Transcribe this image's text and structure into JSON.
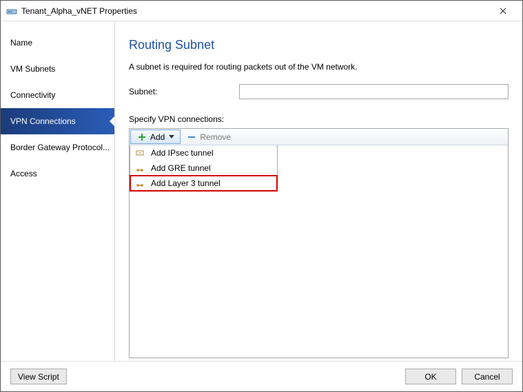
{
  "window": {
    "title": "Tenant_Alpha_vNET Properties"
  },
  "sidebar": {
    "items": [
      {
        "label": "Name",
        "selected": false
      },
      {
        "label": "VM Subnets",
        "selected": false
      },
      {
        "label": "Connectivity",
        "selected": false
      },
      {
        "label": "VPN Connections",
        "selected": true
      },
      {
        "label": "Border Gateway Protocol...",
        "selected": false
      },
      {
        "label": "Access",
        "selected": false
      }
    ]
  },
  "main": {
    "heading": "Routing Subnet",
    "description": "A subnet is required for routing packets out of the VM network.",
    "subnet_label": "Subnet:",
    "subnet_value": "",
    "vpn_label": "Specify VPN connections:",
    "toolbar": {
      "add_label": "Add",
      "remove_label": "Remove"
    },
    "add_menu": {
      "items": [
        {
          "label": "Add IPsec tunnel",
          "highlight": false
        },
        {
          "label": "Add GRE tunnel",
          "highlight": false
        },
        {
          "label": "Add Layer 3 tunnel",
          "highlight": true
        }
      ]
    }
  },
  "footer": {
    "view_script": "View Script",
    "ok": "OK",
    "cancel": "Cancel"
  }
}
